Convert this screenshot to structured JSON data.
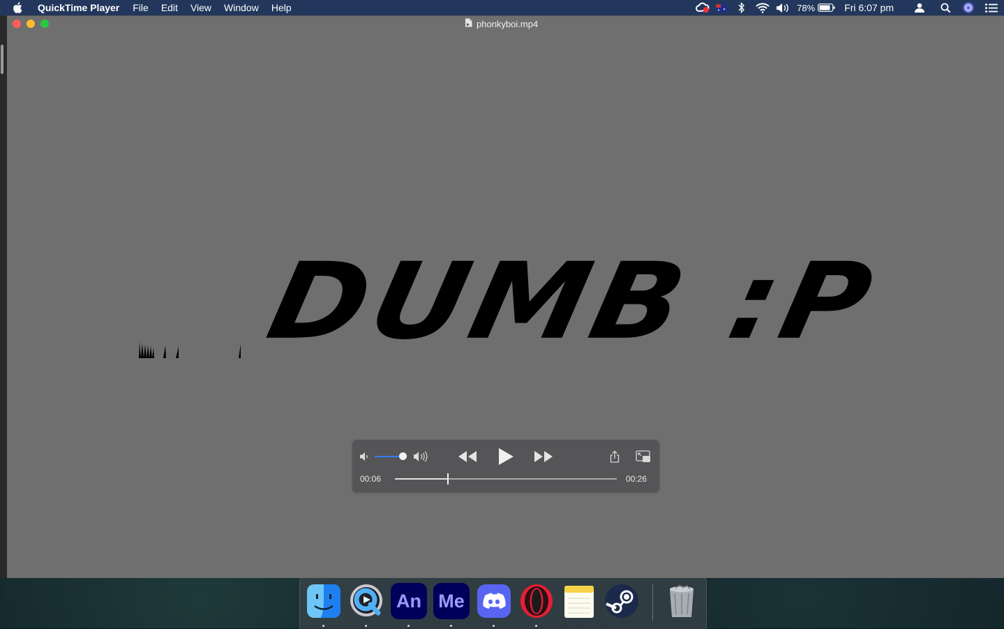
{
  "menubar": {
    "app_name": "QuickTime Player",
    "menus": [
      "File",
      "Edit",
      "View",
      "Window",
      "Help"
    ],
    "battery_percent": "78%",
    "clock": "Fri 6:07 pm",
    "status_icons": [
      "creative-cloud-icon",
      "flag-icon",
      "bluetooth-icon",
      "wifi-icon",
      "volume-icon",
      "battery-icon",
      "user-icon",
      "spotlight-icon",
      "siri-icon",
      "notification-center-icon"
    ]
  },
  "window": {
    "title": "phonkyboi.mp4"
  },
  "video": {
    "text": "DUMB :P"
  },
  "controls": {
    "current_time": "00:06",
    "duration": "00:26",
    "progress_fraction": 0.24,
    "volume_fraction": 0.88,
    "accent": "#2f7ff0"
  },
  "dock": {
    "apps": [
      {
        "name": "Finder",
        "icon": "finder-icon",
        "running": true
      },
      {
        "name": "QuickTime Player",
        "icon": "quicktime-icon",
        "running": true
      },
      {
        "name": "Animate",
        "icon": "animate-icon",
        "label": "An",
        "running": true
      },
      {
        "name": "Media Encoder",
        "icon": "media-encoder-icon",
        "label": "Me",
        "running": true
      },
      {
        "name": "Discord",
        "icon": "discord-icon",
        "running": true
      },
      {
        "name": "Opera",
        "icon": "opera-icon",
        "running": true
      },
      {
        "name": "Notes",
        "icon": "notes-icon",
        "running": false
      },
      {
        "name": "Steam",
        "icon": "steam-icon",
        "running": false
      },
      {
        "name": "Trash",
        "icon": "trash-icon",
        "running": false
      }
    ]
  }
}
